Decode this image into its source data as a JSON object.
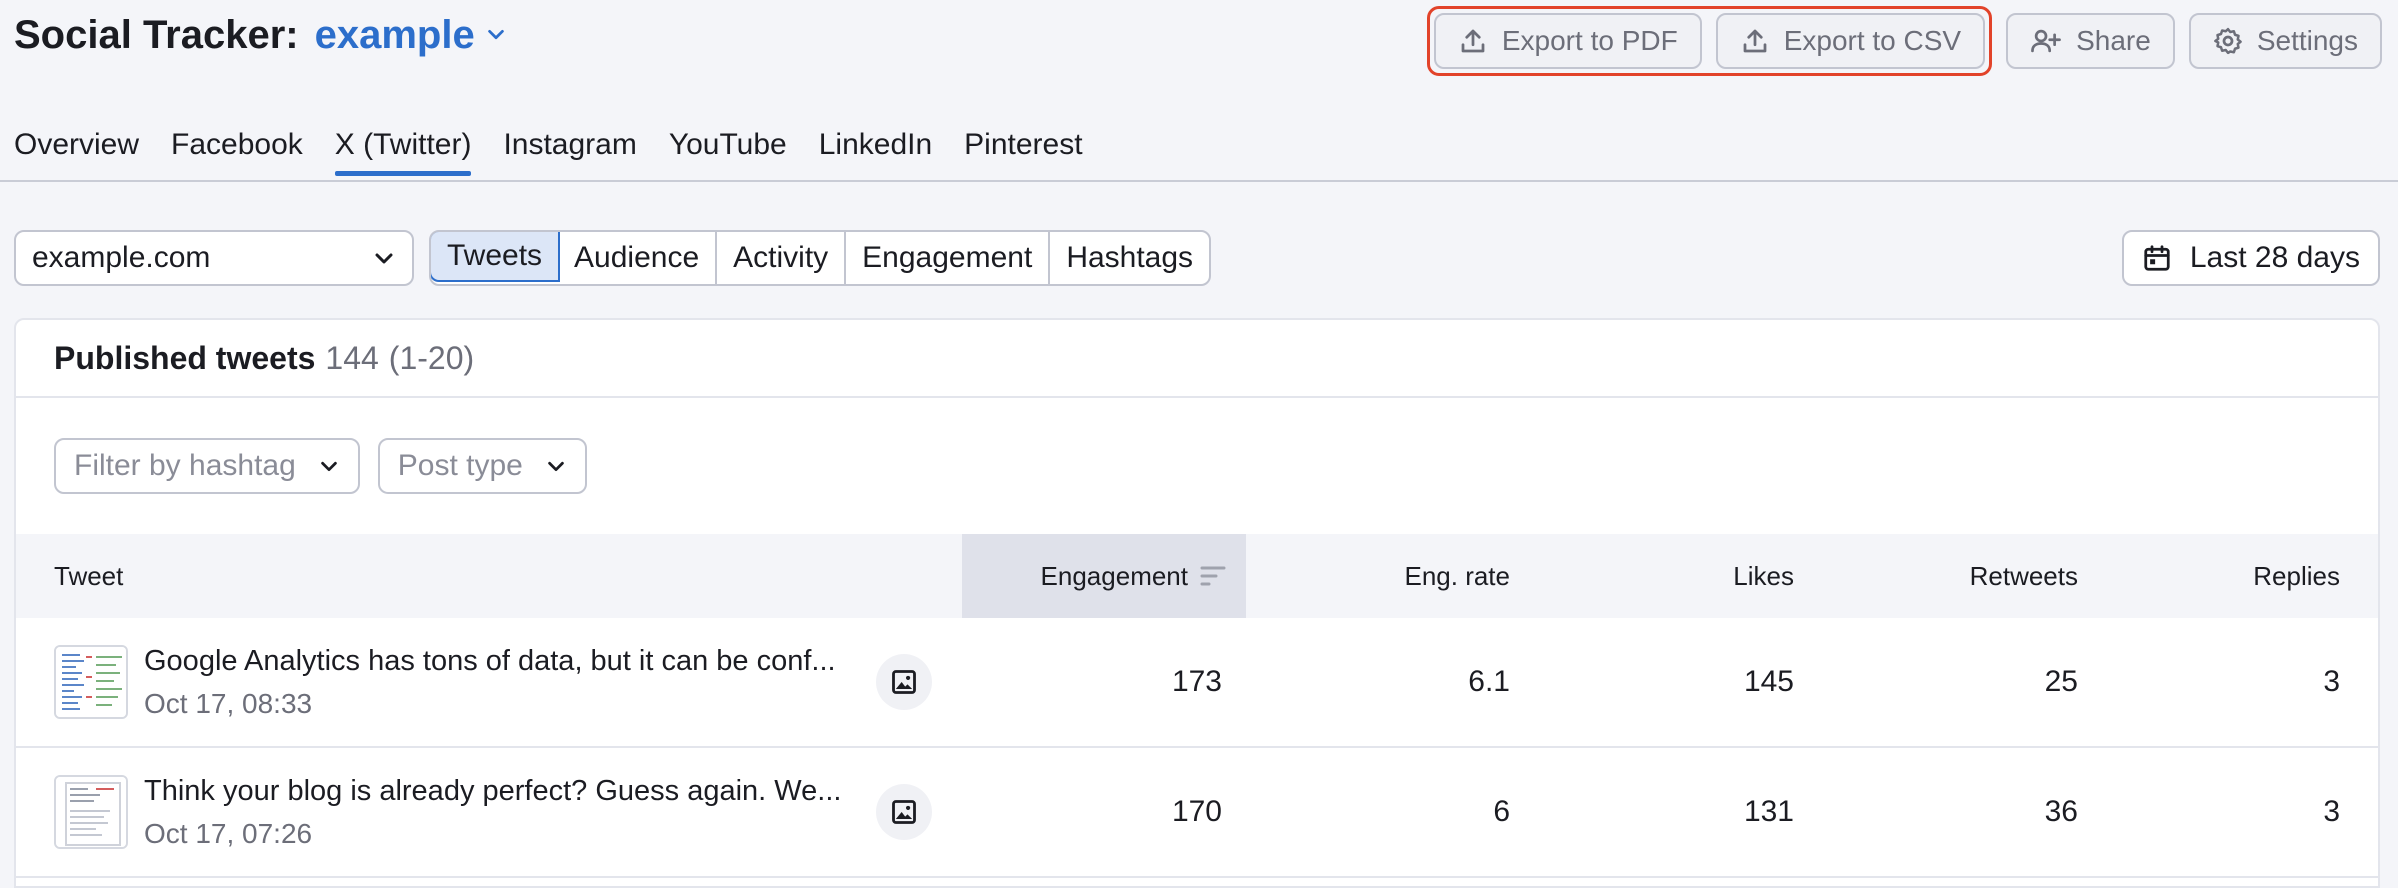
{
  "header": {
    "title": "Social Tracker:",
    "project": "example",
    "actions": {
      "export_pdf": "Export to PDF",
      "export_csv": "Export to CSV",
      "share": "Share",
      "settings": "Settings"
    }
  },
  "network_tabs": [
    "Overview",
    "Facebook",
    "X (Twitter)",
    "Instagram",
    "YouTube",
    "LinkedIn",
    "Pinterest"
  ],
  "active_network_tab": "X (Twitter)",
  "controls": {
    "domain": "example.com",
    "segments": [
      "Tweets",
      "Audience",
      "Activity",
      "Engagement",
      "Hashtags"
    ],
    "active_segment": "Tweets",
    "date_range": "Last 28 days"
  },
  "panel": {
    "title": "Published tweets",
    "count": "144",
    "range": "(1-20)",
    "filters": {
      "hashtag_placeholder": "Filter by hashtag",
      "post_type_placeholder": "Post type"
    }
  },
  "table": {
    "columns": {
      "tweet": "Tweet",
      "engagement": "Engagement",
      "eng_rate": "Eng. rate",
      "likes": "Likes",
      "retweets": "Retweets",
      "replies": "Replies"
    },
    "rows": [
      {
        "text": "Google Analytics has tons of data, but it can be conf...",
        "date": "Oct 17, 08:33",
        "engagement": "173",
        "eng_rate": "6.1",
        "likes": "145",
        "retweets": "25",
        "replies": "3"
      },
      {
        "text": "Think your blog is already perfect? Guess again. We...",
        "date": "Oct 17, 07:26",
        "engagement": "170",
        "eng_rate": "6",
        "likes": "131",
        "retweets": "36",
        "replies": "3"
      }
    ]
  },
  "colors": {
    "accent": "#2c6ecb",
    "highlight_outline": "#e2432a"
  }
}
